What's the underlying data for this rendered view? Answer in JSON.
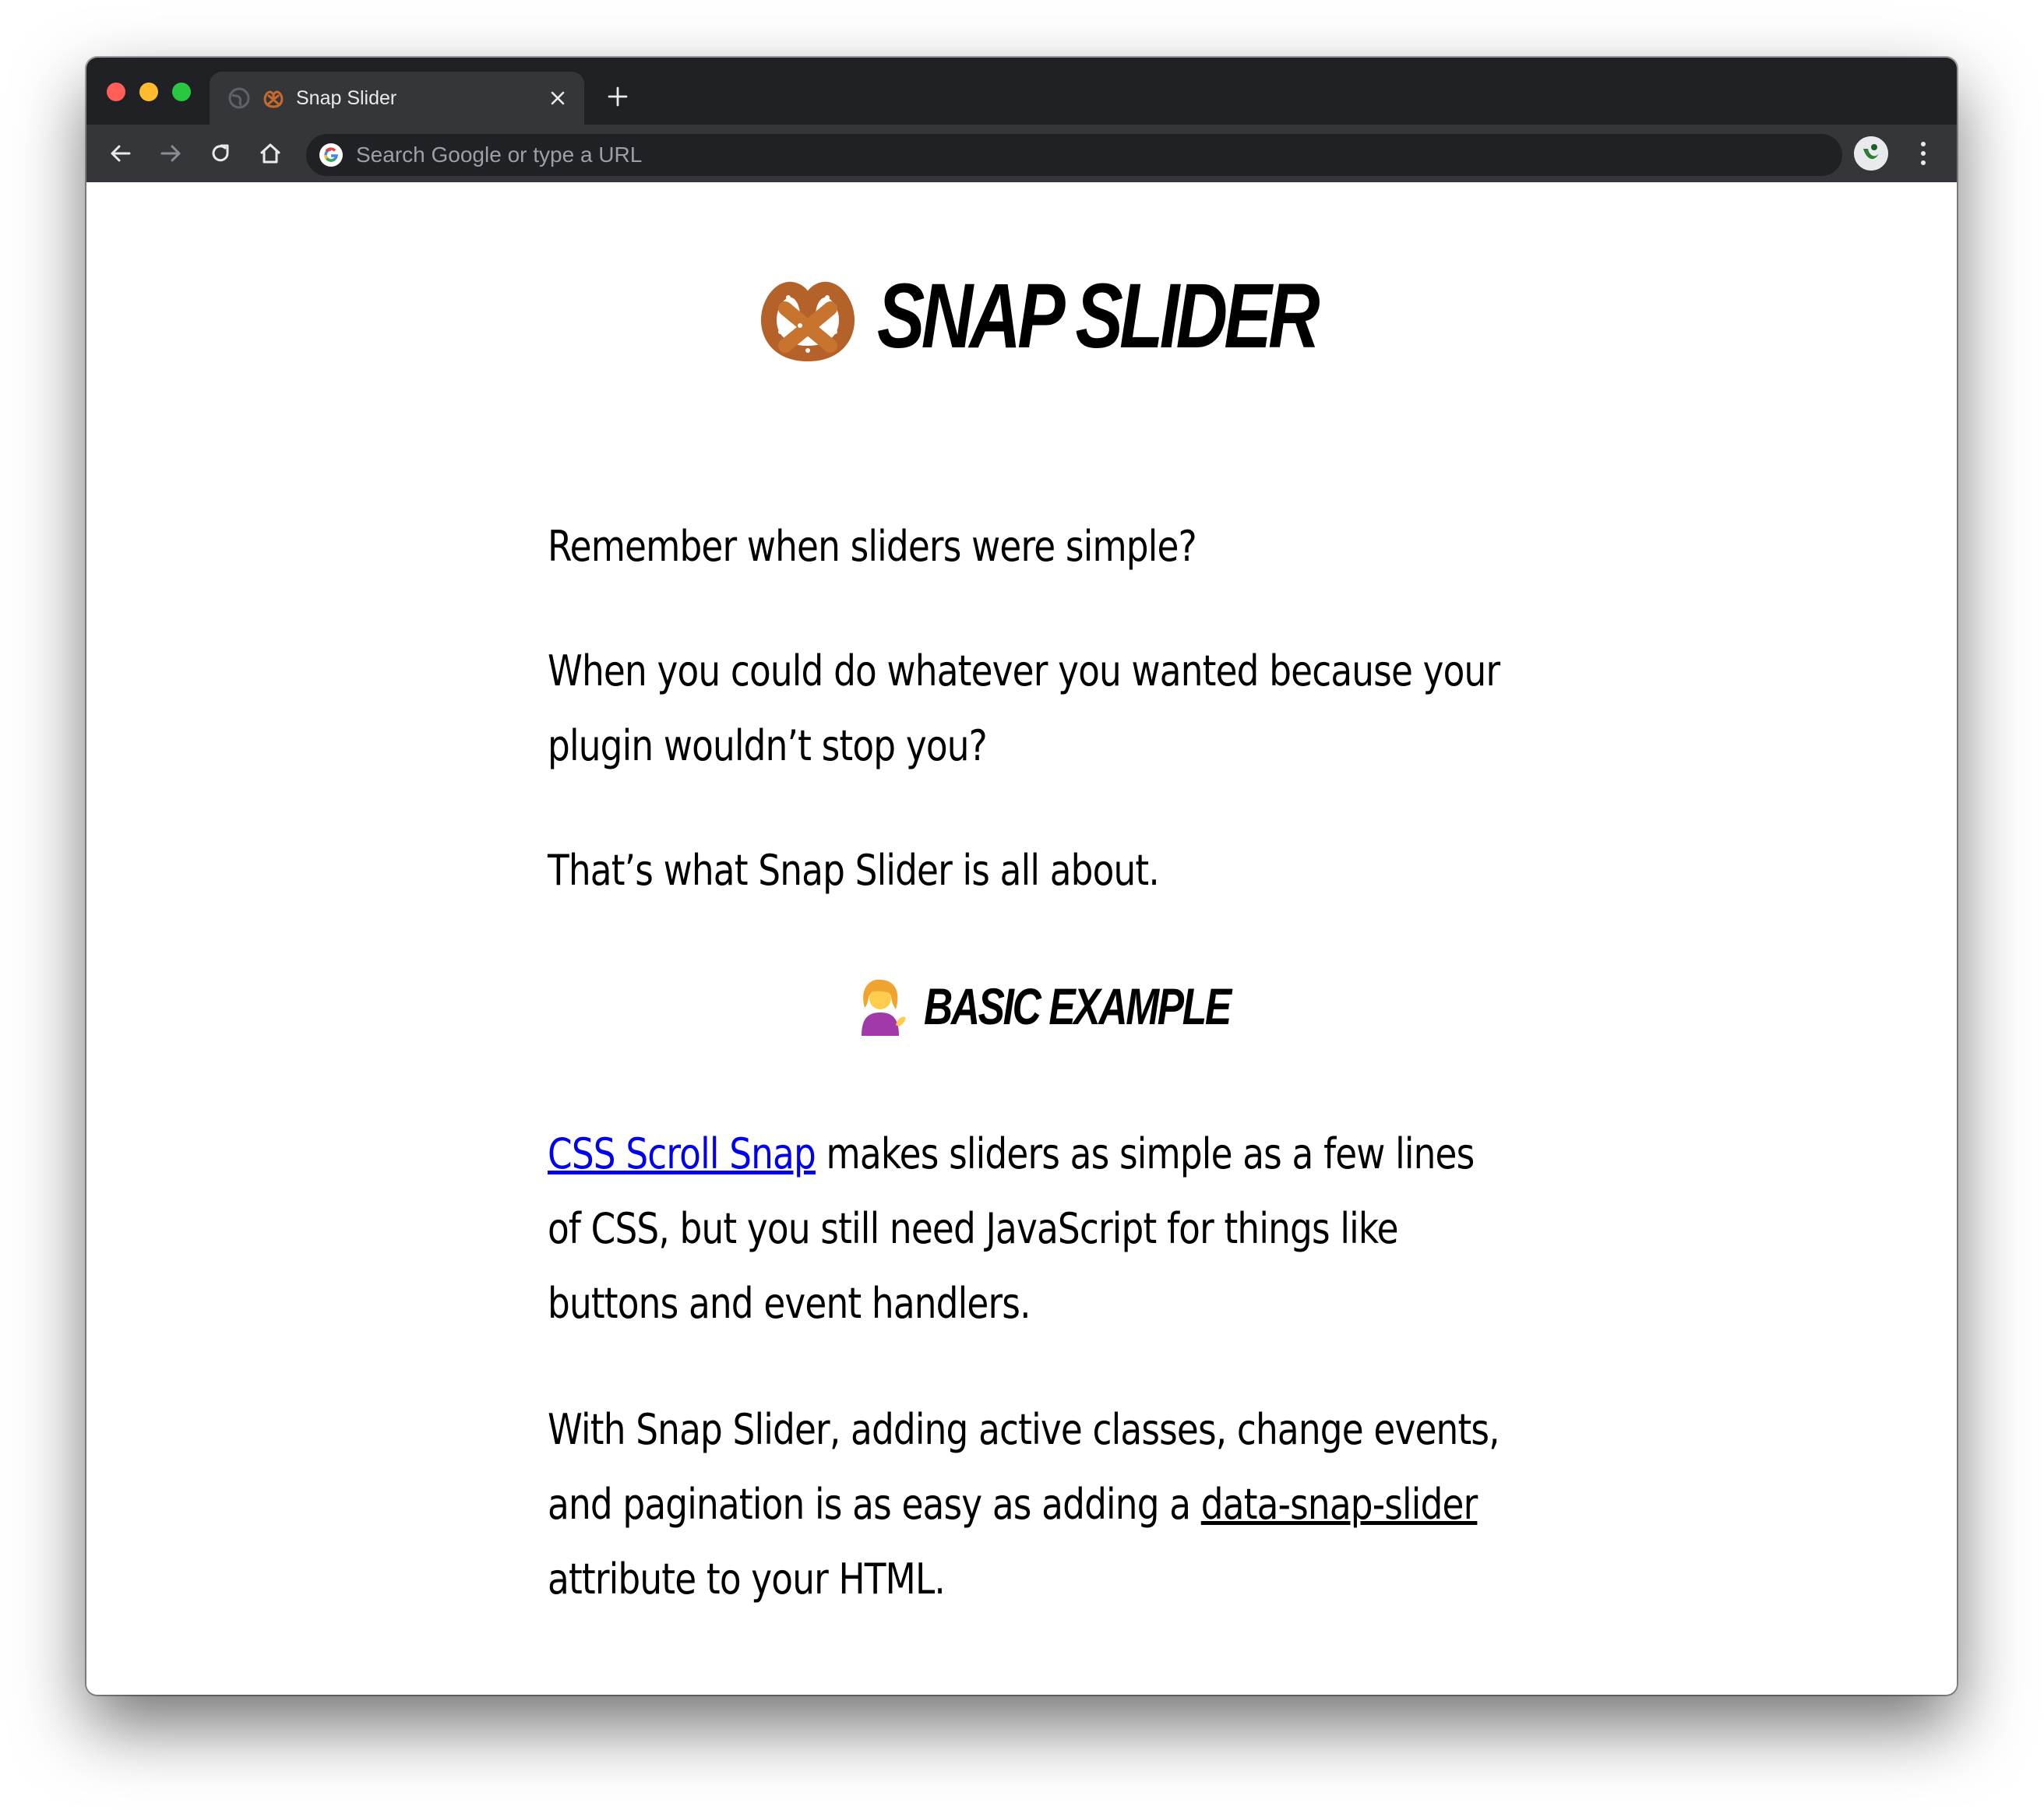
{
  "browser": {
    "tab_title": "Snap Slider",
    "omnibox_placeholder": "Search Google or type a URL",
    "colors": {
      "close": "#ff5f57",
      "minimize": "#febc2e",
      "maximize": "#28c840"
    }
  },
  "page": {
    "title": "Snap Slider",
    "title_emoji": "pretzel",
    "intro": [
      "Remember when sliders were simple?",
      "When you could do whatever you wanted because your plugin wouldn’t stop you?",
      "That’s what Snap Slider is all about."
    ],
    "section_heading": "Basic Example",
    "section_emoji": "person-tipping-hand",
    "para1": {
      "link_text": "CSS Scroll Snap",
      "rest": " makes sliders as simple as a few lines of CSS, but you still need JavaScript for things like buttons and event handlers."
    },
    "para2": {
      "before": "With Snap Slider, adding active classes, change events, and pagination is as easy as adding a ",
      "attribute_link": "data-snap-slider",
      "after": " attribute to your HTML."
    }
  }
}
